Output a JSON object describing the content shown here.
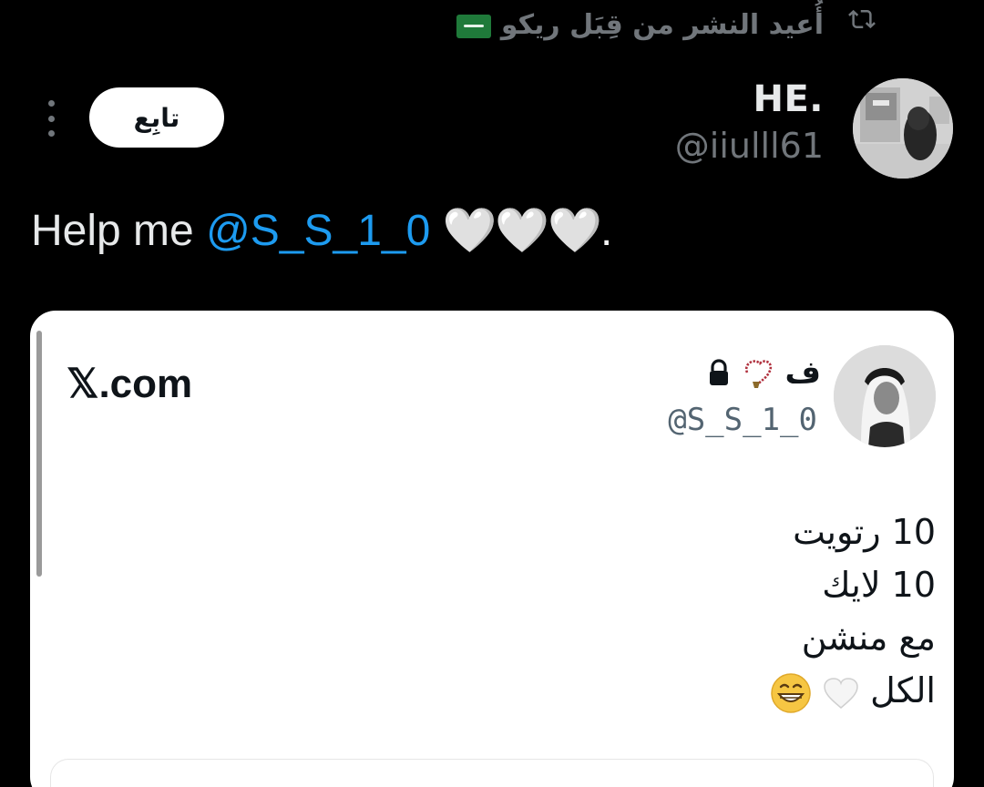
{
  "repost": {
    "label": "أُعيد النشر من قِبَل ريكو",
    "flag_icon": "saudi-flag-icon",
    "icon": "repost-icon"
  },
  "author": {
    "name": "HE.",
    "handle": "@iiulll61",
    "follow_label": "تابِع"
  },
  "tweet": {
    "text_prefix": "Help me ",
    "mention": "@S_S_1_0",
    "suffix": "🤍🤍🤍."
  },
  "card": {
    "source_label": "𝕏.com",
    "inner_author": {
      "name": "ف",
      "handle": "@S_S_1_0"
    },
    "lines": [
      "10 رتويت",
      "10 لايك",
      "مع منشن",
      "الكل"
    ]
  },
  "colors": {
    "background": "#000000",
    "muted": "#71767b",
    "accent": "#1d9bf0",
    "primary_text": "#e7e9ea"
  }
}
